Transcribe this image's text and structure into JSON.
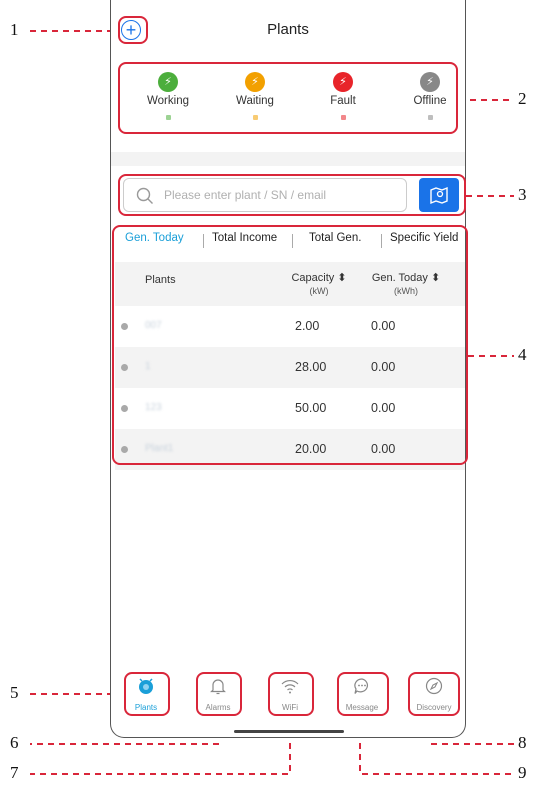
{
  "app": {
    "title": "Plants",
    "add_symbol": "+"
  },
  "status": [
    {
      "label": "Working",
      "color": "#4cae3c",
      "glyph": "⚡"
    },
    {
      "label": "Waiting",
      "color": "#f2a000",
      "glyph": "⚡"
    },
    {
      "label": "Fault",
      "color": "#e8242a",
      "glyph": "⚡"
    },
    {
      "label": "Offline",
      "color": "#888888",
      "glyph": "⚡"
    }
  ],
  "search": {
    "placeholder": "Please enter plant / SN / email",
    "map_icon": "map-pin-icon"
  },
  "tabs": [
    {
      "label": "Gen. Today",
      "active": true
    },
    {
      "label": "Total Income",
      "active": false
    },
    {
      "label": "Total Gen.",
      "active": false
    },
    {
      "label": "Specific Yield",
      "active": false
    }
  ],
  "table": {
    "headers": {
      "plants": "Plants",
      "capacity": "Capacity ⬍",
      "capacity_unit": "(kW)",
      "gen_today": "Gen. Today ⬍",
      "gen_today_unit": "(kWh)"
    },
    "rows": [
      {
        "name": "007",
        "capacity": "2.00",
        "gen_today": "0.00"
      },
      {
        "name": "1",
        "capacity": "28.00",
        "gen_today": "0.00"
      },
      {
        "name": "123",
        "capacity": "50.00",
        "gen_today": "0.00"
      },
      {
        "name": "Plant1",
        "capacity": "20.00",
        "gen_today": "0.00"
      }
    ]
  },
  "nav": [
    {
      "label": "Plants",
      "icon": "plants-icon",
      "active": true
    },
    {
      "label": "Alarms",
      "icon": "bell-icon",
      "active": false
    },
    {
      "label": "WiFi",
      "icon": "wifi-icon",
      "active": false
    },
    {
      "label": "Message",
      "icon": "message-icon",
      "active": false
    },
    {
      "label": "Discovery",
      "icon": "compass-icon",
      "active": false
    }
  ],
  "callouts": [
    "1",
    "2",
    "3",
    "4",
    "5",
    "6",
    "7",
    "8",
    "9"
  ],
  "colors": {
    "accent": "#1a73e8",
    "tab_active": "#1a9fd8",
    "annotation": "#d9263a"
  }
}
